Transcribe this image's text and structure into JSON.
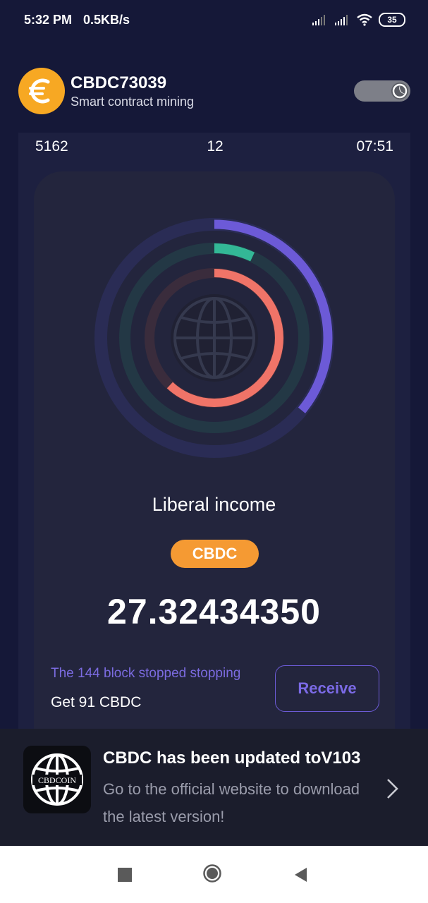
{
  "status_bar": {
    "time": "5:32 PM",
    "net_speed": "0.5KB/s",
    "battery": "35",
    "icons": [
      "signal-icon",
      "signal-icon",
      "wifi-icon",
      "battery-icon"
    ]
  },
  "header": {
    "title": "CBDC73039",
    "subtitle": "Smart contract mining",
    "logo_icon": "euro-coin-icon",
    "toggle_icon": "moon-icon"
  },
  "stats": {
    "left": "5162",
    "middle": "12",
    "right": "07:51"
  },
  "progress_rings": {
    "outer": {
      "fraction": 0.36,
      "color": "#6c5ad7"
    },
    "middle": {
      "fraction": 0.07,
      "color": "#33b896"
    },
    "inner": {
      "fraction": 0.62,
      "color": "#f07468"
    },
    "center_icon": "globe-icon"
  },
  "income": {
    "title": "Liberal income",
    "badge": "CBDC",
    "amount": "27.32434350"
  },
  "reward": {
    "note": "The 144 block stopped stopping",
    "get_line": "Get  91  CBDC",
    "button_label": "Receive"
  },
  "update": {
    "logo_text": "CBDCOIN",
    "title": "CBDC has been updated toV103",
    "description": "Go to the official website to download the latest version!"
  },
  "colors": {
    "background": "#151838",
    "panel": "#1d2040",
    "accent_orange": "#f59a33",
    "accent_purple": "#6c5bd6"
  }
}
